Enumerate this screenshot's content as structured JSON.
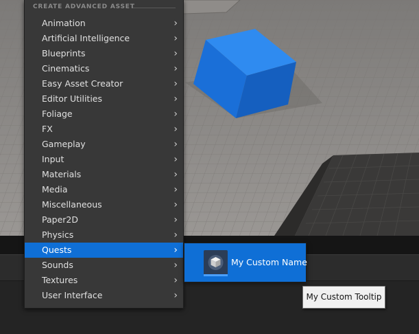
{
  "menu": {
    "header": "CREATE ADVANCED ASSET",
    "items": [
      {
        "label": "Animation"
      },
      {
        "label": "Artificial Intelligence"
      },
      {
        "label": "Blueprints"
      },
      {
        "label": "Cinematics"
      },
      {
        "label": "Easy Asset Creator"
      },
      {
        "label": "Editor Utilities"
      },
      {
        "label": "Foliage"
      },
      {
        "label": "FX"
      },
      {
        "label": "Gameplay"
      },
      {
        "label": "Input"
      },
      {
        "label": "Materials"
      },
      {
        "label": "Media"
      },
      {
        "label": "Miscellaneous"
      },
      {
        "label": "Paper2D"
      },
      {
        "label": "Physics"
      },
      {
        "label": "Quests",
        "highlighted": true
      },
      {
        "label": "Sounds"
      },
      {
        "label": "Textures"
      },
      {
        "label": "User Interface"
      }
    ],
    "chevron_glyph": "›"
  },
  "submenu": {
    "item_label": "My Custom Name",
    "icon": "asset-cube-icon"
  },
  "tooltip": {
    "text": "My Custom Tooltip"
  },
  "colors": {
    "highlight": "#0f6fd6",
    "menu_bg": "#383838",
    "cube": "#1a6fd8"
  }
}
